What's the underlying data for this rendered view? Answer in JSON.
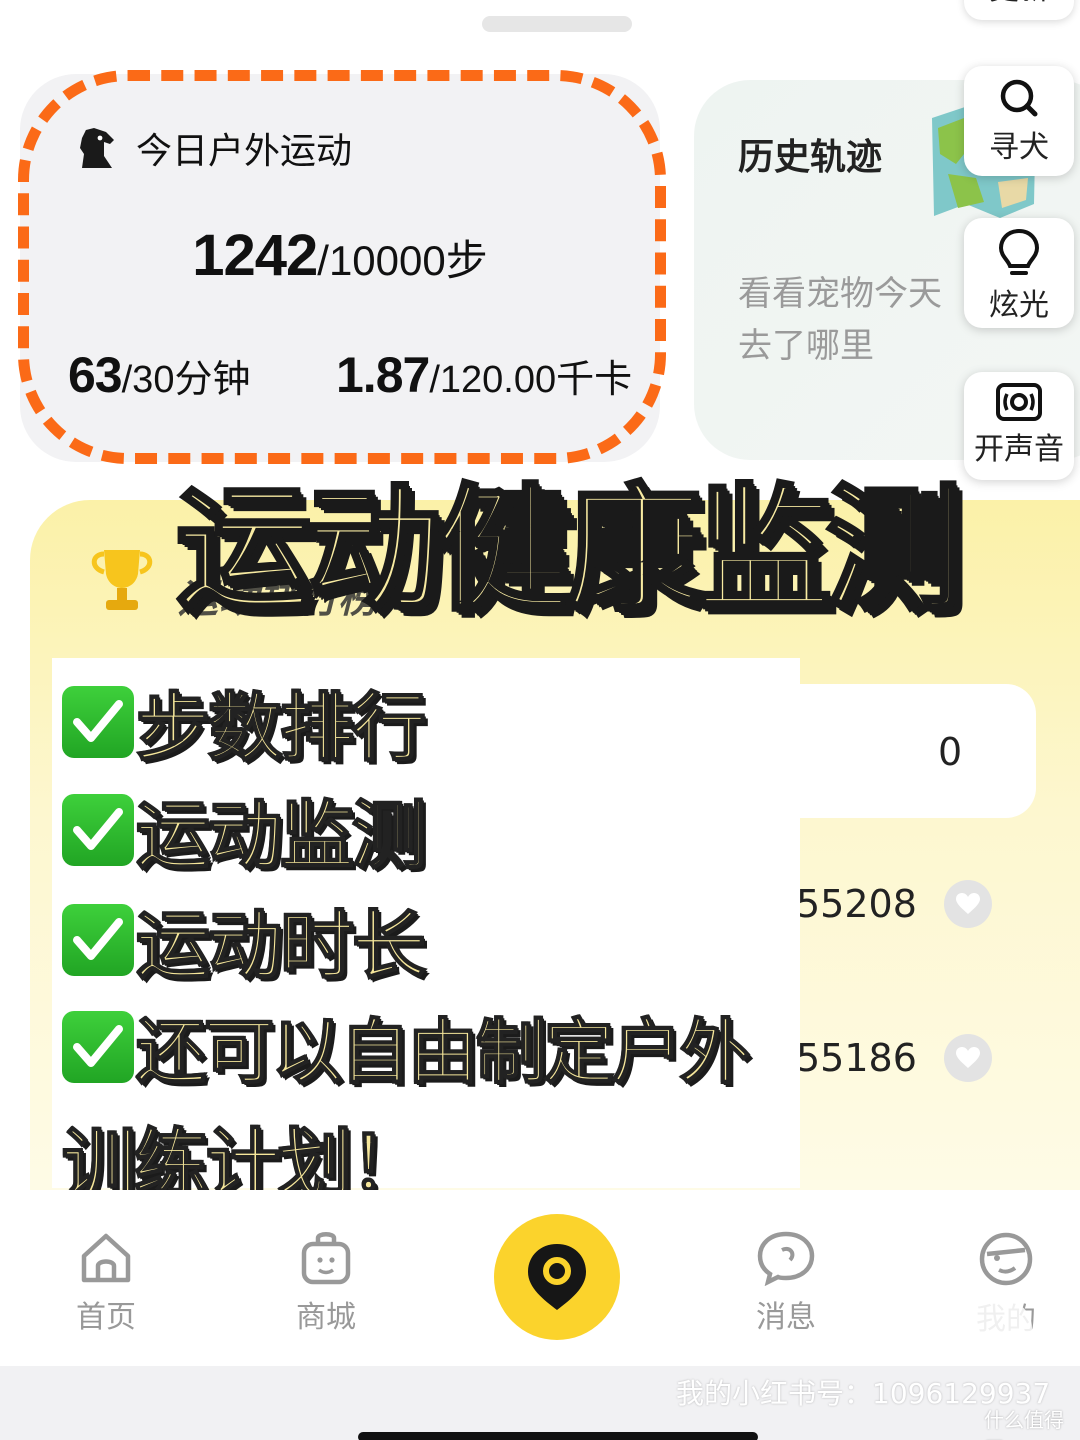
{
  "top": {
    "update_label": "更新"
  },
  "outdoor": {
    "title": "今日户外运动",
    "steps": "1242",
    "steps_goal": "/10000步",
    "minutes": "63",
    "minutes_goal": "/30分钟",
    "kcal": "1.87",
    "kcal_goal": "/120.00千卡",
    "accent": "#fb6a17"
  },
  "history": {
    "title": "历史轨迹",
    "subtitle": "看看宠物今天去了哪里"
  },
  "side_buttons": {
    "find_dog": "寻犬",
    "flash": "炫光",
    "sound": "开声音"
  },
  "headline": "运动健康监测",
  "ranking": {
    "title": "运动排行榜",
    "rows": [
      {
        "value": "0"
      },
      {
        "value": "55208"
      },
      {
        "value": "55186"
      }
    ]
  },
  "checklist": [
    {
      "text": "步数排行"
    },
    {
      "text": "运动监测"
    },
    {
      "text": "运动时长"
    },
    {
      "text": "还可以自由制定户外"
    }
  ],
  "checklist_tail": "训练计划！",
  "nav": {
    "home": "首页",
    "shop": "商城",
    "messages": "消息",
    "me": "我的"
  },
  "watermark": "我的小红书号：1096129937",
  "watermark_site": "什么值得买",
  "logo_text": "小红书",
  "colors": {
    "nav_center": "#fbd32c",
    "rank_bg": "#fbf1a8",
    "check_green": "#2bb52c"
  }
}
